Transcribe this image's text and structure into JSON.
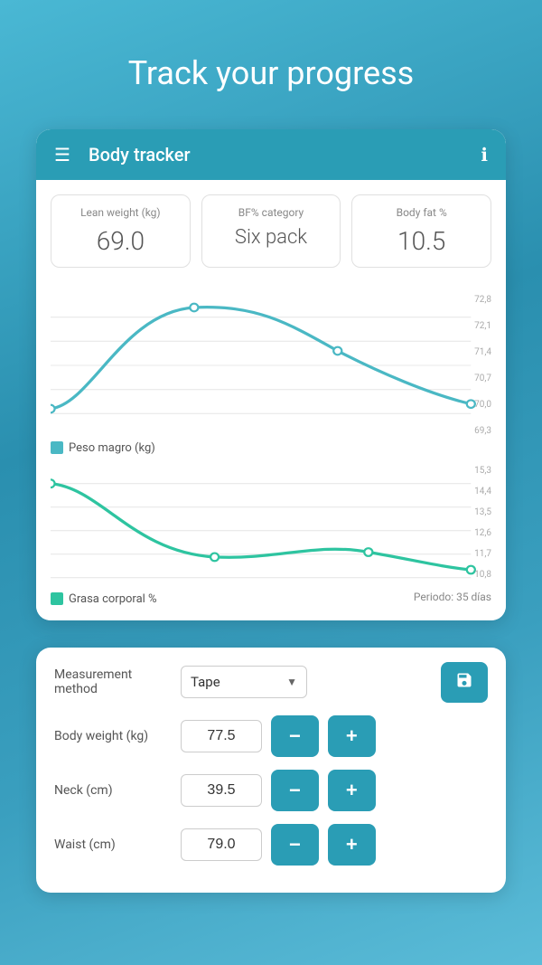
{
  "page": {
    "title": "Track your progress"
  },
  "appbar": {
    "title": "Body tracker",
    "menu_icon": "☰",
    "info_icon": "ℹ"
  },
  "stats": [
    {
      "label": "Lean weight (kg)",
      "value": "69.0",
      "type": "number"
    },
    {
      "label": "BF% category",
      "value": "Six pack",
      "type": "text"
    },
    {
      "label": "Body fat %",
      "value": "10.5",
      "type": "number"
    }
  ],
  "chart1": {
    "y_labels": [
      "72,8",
      "72,1",
      "71,4",
      "70,7",
      "70,0",
      "69,3"
    ],
    "legend_label": "Peso magro (kg)",
    "legend_color": "#4ab8c4"
  },
  "chart2": {
    "y_labels": [
      "15,3",
      "14,4",
      "13,5",
      "12,6",
      "11,7",
      "10,8"
    ],
    "legend_label": "Grasa corporal %",
    "legend_color": "#2ec4a0",
    "periodo": "Periodo: 35 días"
  },
  "inputs": {
    "measurement_method_label": "Measurement method",
    "measurement_method_value": "Tape",
    "body_weight_label": "Body weight (kg)",
    "body_weight_value": "77.5",
    "neck_label": "Neck (cm)",
    "neck_value": "39.5",
    "waist_label": "Waist (cm)",
    "waist_value": "79.0",
    "save_icon": "💾",
    "minus_label": "−",
    "plus_label": "+"
  }
}
